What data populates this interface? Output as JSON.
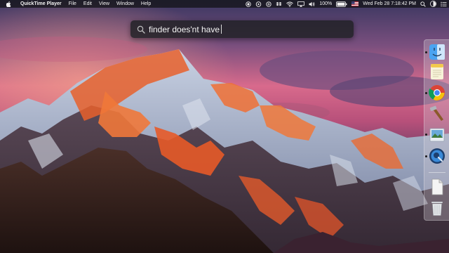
{
  "menubar": {
    "app_name": "QuickTime Player",
    "menus": [
      "File",
      "Edit",
      "View",
      "Window",
      "Help"
    ],
    "battery": "100%",
    "datetime": "Wed Feb 28  7:18:42 PM"
  },
  "spotlight": {
    "query": "finder does'nt have"
  },
  "dock": {
    "items": [
      "finder-icon",
      "notes-icon",
      "chrome-icon",
      "xcode-icon",
      "preview-icon",
      "quicktime-icon",
      "document-icon",
      "trash-icon"
    ]
  },
  "colors": {
    "menubar": "#14141a",
    "spotlight": "#222226",
    "sky_top": "#3b3358",
    "sky_glow": "#e0608a",
    "mountain_glow": "#f0602a"
  }
}
